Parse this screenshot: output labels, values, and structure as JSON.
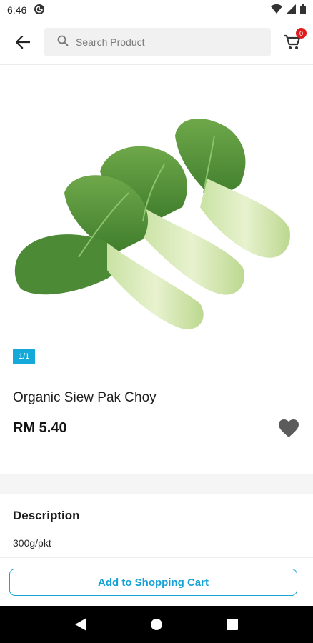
{
  "status_bar": {
    "time": "6:46"
  },
  "header": {
    "search_placeholder": "Search Product",
    "cart_count": "0"
  },
  "product": {
    "image_pager": "1/1",
    "name": "Organic Siew Pak Choy",
    "price": "RM 5.40"
  },
  "description": {
    "title": "Description",
    "text": "300g/pkt"
  },
  "actions": {
    "add_to_cart_label": "Add to Shopping Cart"
  },
  "icons": {
    "back": "arrow-left-icon",
    "search": "search-icon",
    "cart": "shopping-cart-icon",
    "favorite": "heart-icon"
  },
  "colors": {
    "accent": "#14a9d9",
    "badge": "#e21b1b",
    "favorite_icon": "#5b5b5b"
  }
}
